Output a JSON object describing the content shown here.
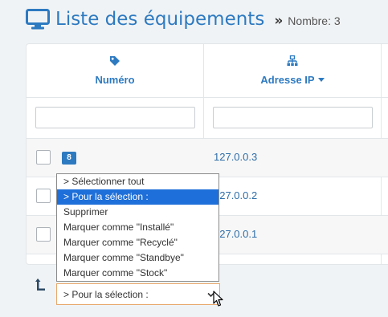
{
  "header": {
    "title": "Liste des équipements",
    "separator": "»",
    "count_label": "Nombre: 3",
    "icon": "desktop-monitor-icon"
  },
  "table": {
    "columns": [
      {
        "label": "Numéro",
        "icon": "tag-icon",
        "sortable": false
      },
      {
        "label": "Adresse IP",
        "icon": "network-icon",
        "sort_indicator": "caret-down-icon"
      }
    ],
    "rows": [
      {
        "badge": "8",
        "ip": "127.0.0.3"
      },
      {
        "badge": "",
        "ip": "127.0.0.2"
      },
      {
        "badge": "",
        "ip": "127.0.0.1"
      }
    ]
  },
  "bulk_action": {
    "selected_value": "> Pour la sélection :",
    "options": [
      "> Sélectionner tout",
      "> Pour la sélection :",
      "Supprimer",
      "Marquer comme \"Installé\"",
      "Marquer comme \"Recyclé\"",
      "Marquer comme \"Standbye\"",
      "Marquer comme \"Stock\""
    ],
    "highlighted_index": 1
  },
  "colors": {
    "accent": "#2d7ac1",
    "select_border": "#e8a96d",
    "option_highlight": "#1e6fd9"
  }
}
